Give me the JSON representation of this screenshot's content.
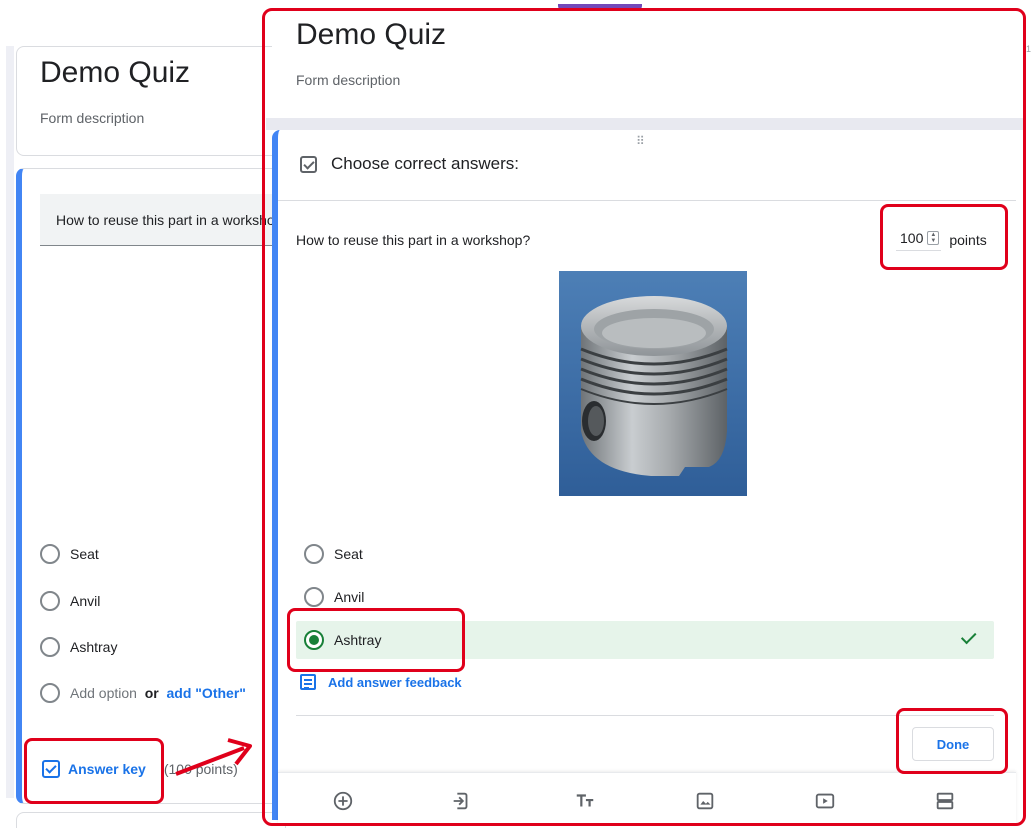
{
  "background_form": {
    "title": "Demo Quiz",
    "description": "Form description",
    "question": "How to reuse this part in a workshop?",
    "options": [
      "Seat",
      "Anvil",
      "Ashtray"
    ],
    "add_option": "Add option",
    "or": "or",
    "add_other": "add \"Other\"",
    "answer_key_label": "Answer key",
    "points_summary": "(100 points)"
  },
  "answer_key_dialog": {
    "title": "Demo Quiz",
    "description": "Form description",
    "header": "Choose correct answers:",
    "question": "How to reuse this part in a workshop?",
    "points_value": "100",
    "points_label": "points",
    "options": [
      {
        "label": "Seat",
        "selected": false
      },
      {
        "label": "Anvil",
        "selected": false
      },
      {
        "label": "Ashtray",
        "selected": true
      }
    ],
    "feedback_link": "Add answer feedback",
    "done_label": "Done"
  },
  "toolbar_icons": [
    "add-question-icon",
    "import-questions-icon",
    "add-title-icon",
    "add-image-icon",
    "add-video-icon",
    "add-section-icon"
  ],
  "side_digit": "1",
  "colors": {
    "accent_blue": "#1a73e8",
    "card_accent": "#4285f4",
    "correct_green": "#188038",
    "correct_bg": "#e6f4ea",
    "annotation_red": "#e0001b",
    "theme_purple": "#7248b9"
  }
}
